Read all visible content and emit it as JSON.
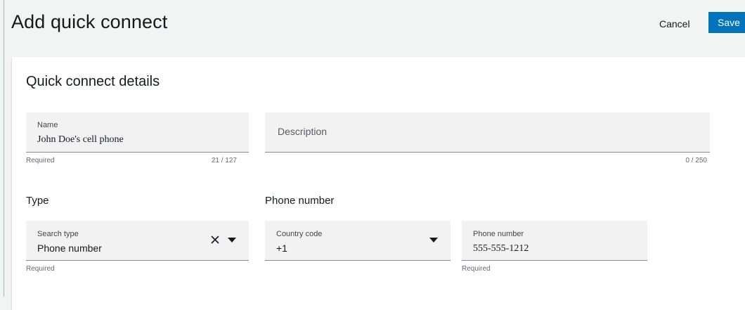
{
  "header": {
    "title": "Add quick connect",
    "cancel_label": "Cancel",
    "save_label": "Save"
  },
  "details": {
    "section_title": "Quick connect details",
    "name": {
      "label": "Name",
      "value": "John Doe's cell phone",
      "helper": "Required",
      "counter": "21 / 127"
    },
    "description": {
      "placeholder": "Description",
      "counter": "0 / 250"
    }
  },
  "type": {
    "title": "Type",
    "search": {
      "label": "Search type",
      "value": "Phone number",
      "helper": "Required",
      "icons": [
        "close-icon",
        "caret-down-icon"
      ]
    }
  },
  "phone": {
    "title": "Phone number",
    "country": {
      "label": "Country code",
      "value": "+1",
      "icons": [
        "caret-down-icon"
      ]
    },
    "number": {
      "label": "Phone number",
      "value": "555-555-1212",
      "helper": "Required"
    }
  },
  "colors": {
    "primary": "#0073bb",
    "field_bg": "#f2f2f2",
    "page_bg": "#f2f3f3"
  }
}
